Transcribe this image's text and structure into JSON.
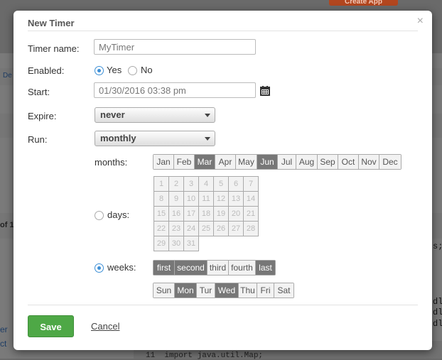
{
  "background": {
    "create_button": "Create App",
    "left_fragments": [
      "De",
      "of 1",
      "er",
      "ct"
    ],
    "right_fragments": [
      "s;",
      "dl",
      "dl",
      "dl"
    ],
    "code_line_number": "11",
    "code_line_text": "import java.util.Map;"
  },
  "modal": {
    "title": "New Timer",
    "close_glyph": "×",
    "timer_name": {
      "label": "Timer name:",
      "value": "MyTimer"
    },
    "enabled": {
      "label": "Enabled:",
      "yes": "Yes",
      "no": "No",
      "selected": "Yes"
    },
    "start": {
      "label": "Start:",
      "value": "01/30/2016 03:38 pm",
      "icon": "calendar-icon"
    },
    "expire": {
      "label": "Expire:",
      "value": "never"
    },
    "run": {
      "label": "Run:",
      "value": "monthly"
    },
    "months": {
      "label": "months:",
      "items": [
        "Jan",
        "Feb",
        "Mar",
        "Apr",
        "May",
        "Jun",
        "Jul",
        "Aug",
        "Sep",
        "Oct",
        "Nov",
        "Dec"
      ],
      "selected": [
        "Mar",
        "Jun"
      ]
    },
    "days": {
      "label": "days:",
      "rows": [
        [
          "1",
          "2",
          "3",
          "4",
          "5",
          "6",
          "7"
        ],
        [
          "8",
          "9",
          "10",
          "11",
          "12",
          "13",
          "14"
        ],
        [
          "15",
          "16",
          "17",
          "18",
          "19",
          "20",
          "21"
        ],
        [
          "22",
          "23",
          "24",
          "25",
          "26",
          "27",
          "28"
        ],
        [
          "29",
          "30",
          "31"
        ]
      ]
    },
    "weeks": {
      "label": "weeks:",
      "items": [
        "first",
        "second",
        "third",
        "fourth",
        "last"
      ],
      "selected": [
        "first",
        "second",
        "last"
      ]
    },
    "weekdays": {
      "items": [
        "Sun",
        "Mon",
        "Tur",
        "Wed",
        "Thu",
        "Fri",
        "Sat"
      ],
      "selected": [
        "Mon",
        "Wed"
      ]
    },
    "save_label": "Save",
    "cancel_label": "Cancel"
  },
  "colors": {
    "save": "#4ea846",
    "selected_segment": "#777777",
    "radio_accent": "#3d8fd6"
  }
}
